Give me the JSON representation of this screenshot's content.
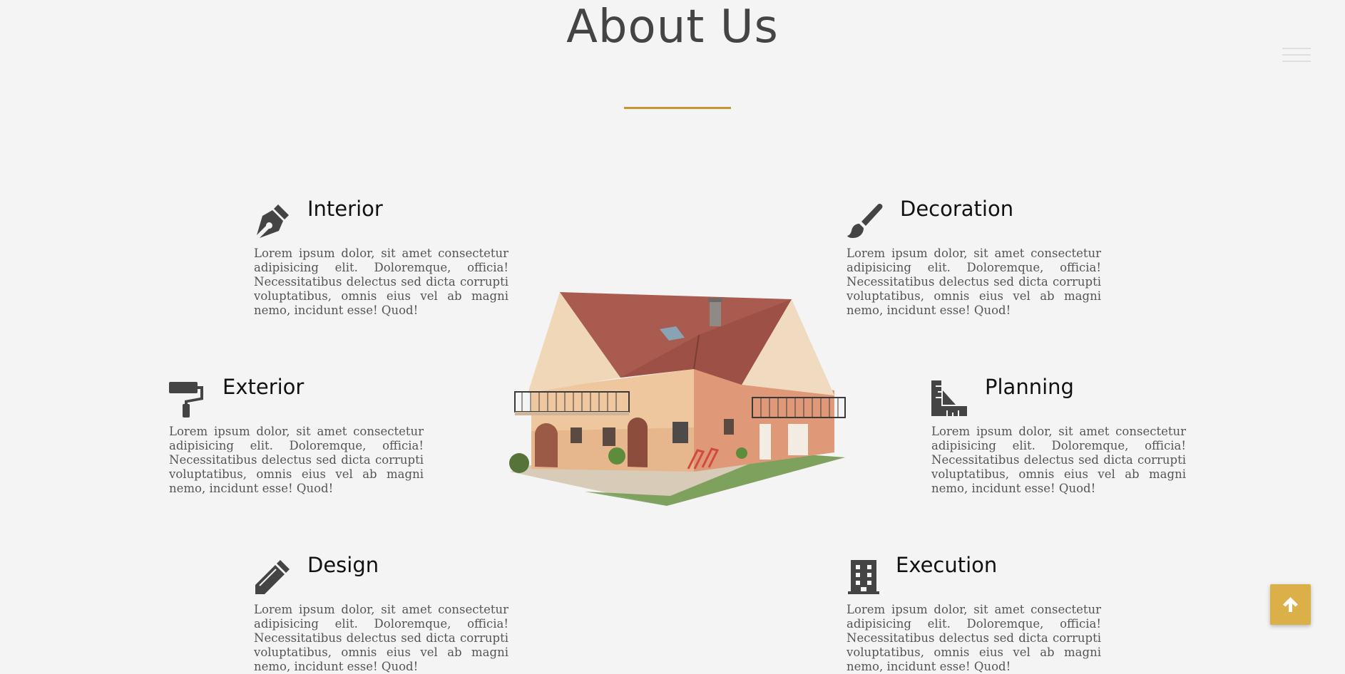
{
  "page": {
    "title": "About Us",
    "accent_color": "#c9962e"
  },
  "nav": {
    "menu_icon": "hamburger-menu-icon"
  },
  "features": [
    {
      "heading": "Interior",
      "icon": "pen-nib-icon",
      "text": "Lorem ipsum dolor, sit amet consectetur adipisicing elit. Doloremque, officia! Necessitatibus delectus sed dicta corrupti voluptatibus, omnis eius vel ab magni nemo, incidunt esse! Quod!"
    },
    {
      "heading": "Decoration",
      "icon": "paint-brush-icon",
      "text": "Lorem ipsum dolor, sit amet consectetur adipisicing elit. Doloremque, officia! Necessitatibus delectus sed dicta corrupti voluptatibus, omnis eius vel ab magni nemo, incidunt esse! Quod!"
    },
    {
      "heading": "Exterior",
      "icon": "paint-roller-icon",
      "text": "Lorem ipsum dolor, sit amet consectetur adipisicing elit. Doloremque, officia! Necessitatibus delectus sed dicta corrupti voluptatibus, omnis eius vel ab magni nemo, incidunt esse! Quod!"
    },
    {
      "heading": "Planning",
      "icon": "ruler-combined-icon",
      "text": "Lorem ipsum dolor, sit amet consectetur adipisicing elit. Doloremque, officia! Necessitatibus delectus sed dicta corrupti voluptatibus, omnis eius vel ab magni nemo, incidunt esse! Quod!"
    },
    {
      "heading": "Design",
      "icon": "pencil-icon",
      "text": "Lorem ipsum dolor, sit amet consectetur adipisicing elit. Doloremque, officia! Necessitatibus delectus sed dicta corrupti voluptatibus, omnis eius vel ab magni nemo, incidunt esse! Quod!"
    },
    {
      "heading": "Execution",
      "icon": "building-icon",
      "text": "Lorem ipsum dolor, sit amet consectetur adipisicing elit. Doloremque, officia! Necessitatibus delectus sed dicta corrupti voluptatibus, omnis eius vel ab magni nemo, incidunt esse! Quod!"
    }
  ],
  "back_to_top": {
    "icon": "arrow-up-icon",
    "color": "#dcb048"
  }
}
